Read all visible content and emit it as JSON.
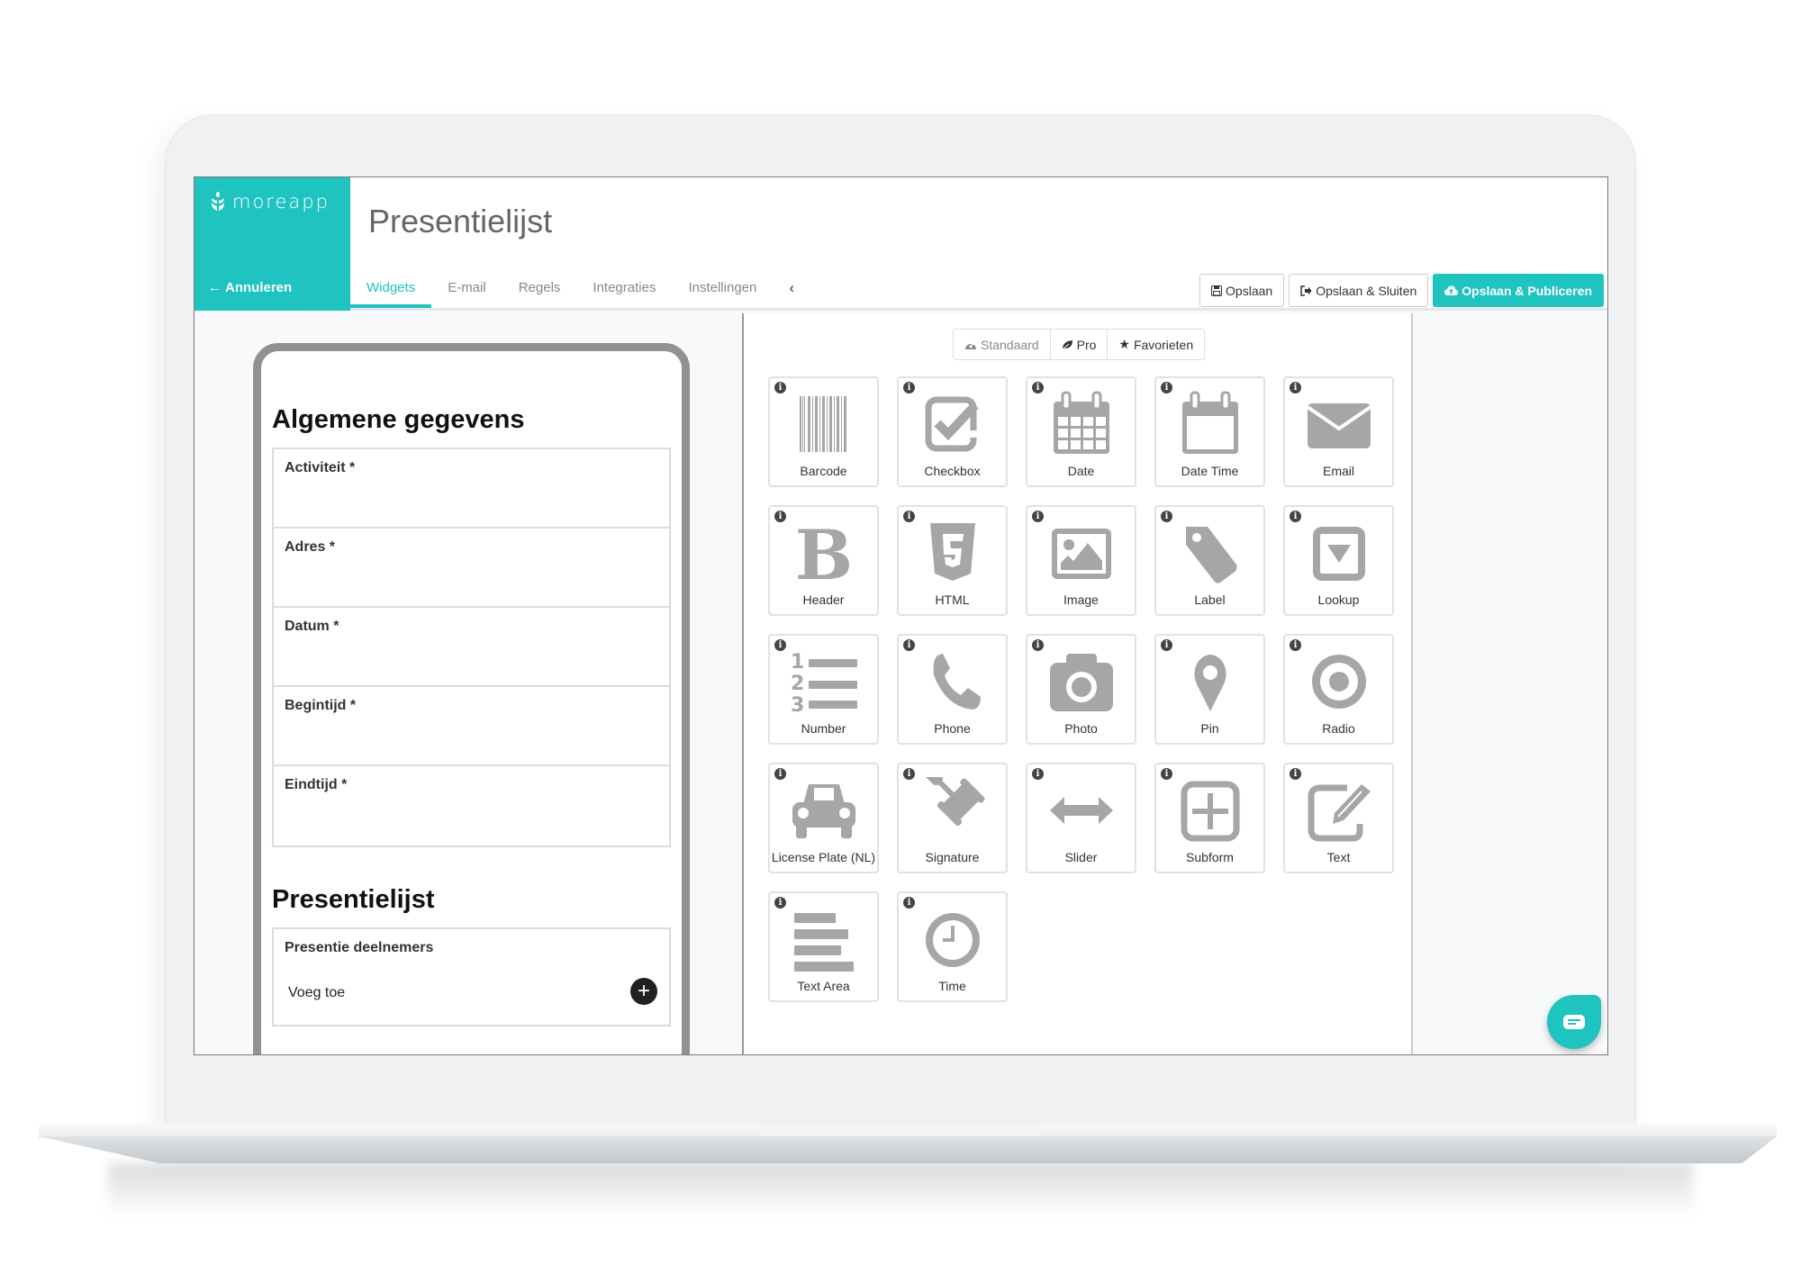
{
  "app": {
    "brand": "moreapp",
    "cancel_label": "Annuleren",
    "brand_color": "#1fc3c0"
  },
  "header": {
    "title": "Presentielijst",
    "tabs": [
      {
        "label": "Widgets",
        "active": true
      },
      {
        "label": "E-mail",
        "active": false
      },
      {
        "label": "Regels",
        "active": false
      },
      {
        "label": "Integraties",
        "active": false
      },
      {
        "label": "Instellingen",
        "active": false
      }
    ],
    "collapse_icon": "chevron-left-icon",
    "actions": {
      "save": "Opslaan",
      "save_close": "Opslaan & Sluiten",
      "save_publish": "Opslaan & Publiceren"
    }
  },
  "preview": {
    "section1_title": "Algemene gegevens",
    "fields": [
      "Activiteit *",
      "Adres *",
      "Datum *",
      "Begintijd *",
      "Eindtijd *"
    ],
    "section2_title": "Presentielijst",
    "repeat_label": "Presentie deelnemers",
    "repeat_add": "Voeg toe"
  },
  "widgets": {
    "filters": [
      {
        "label": "Standaard",
        "icon": "dashboard-icon"
      },
      {
        "label": "Pro",
        "icon": "leaf-icon"
      },
      {
        "label": "Favorieten",
        "icon": "star-icon"
      }
    ],
    "items": [
      {
        "label": "Barcode",
        "icon": "barcode"
      },
      {
        "label": "Checkbox",
        "icon": "checkbox"
      },
      {
        "label": "Date",
        "icon": "date"
      },
      {
        "label": "Date Time",
        "icon": "datetime"
      },
      {
        "label": "Email",
        "icon": "email"
      },
      {
        "label": "Header",
        "icon": "header"
      },
      {
        "label": "HTML",
        "icon": "html"
      },
      {
        "label": "Image",
        "icon": "image"
      },
      {
        "label": "Label",
        "icon": "label"
      },
      {
        "label": "Lookup",
        "icon": "lookup"
      },
      {
        "label": "Number",
        "icon": "number"
      },
      {
        "label": "Phone",
        "icon": "phone"
      },
      {
        "label": "Photo",
        "icon": "photo"
      },
      {
        "label": "Pin",
        "icon": "pin"
      },
      {
        "label": "Radio",
        "icon": "radio"
      },
      {
        "label": "License Plate (NL)",
        "icon": "car"
      },
      {
        "label": "Signature",
        "icon": "gavel"
      },
      {
        "label": "Slider",
        "icon": "slider"
      },
      {
        "label": "Subform",
        "icon": "subform"
      },
      {
        "label": "Text",
        "icon": "text"
      },
      {
        "label": "Text Area",
        "icon": "textarea"
      },
      {
        "label": "Time",
        "icon": "time"
      }
    ],
    "info_glyph": "i"
  }
}
